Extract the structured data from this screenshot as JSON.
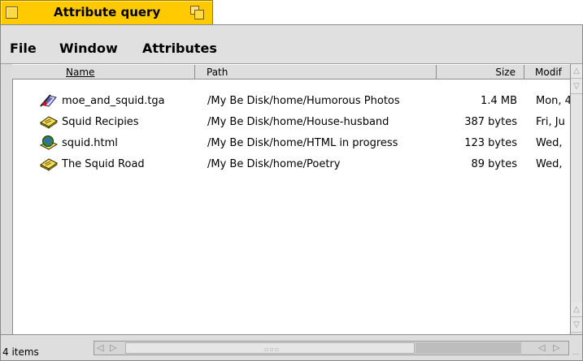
{
  "window": {
    "title": "Attribute query"
  },
  "menu": [
    "File",
    "Window",
    "Attributes"
  ],
  "columns": {
    "name": "Name",
    "path": "Path",
    "size": "Size",
    "modified": "Modif"
  },
  "rows": [
    {
      "icon": "image-file-icon",
      "name": "moe_and_squid.tga",
      "path": "/My Be Disk/home/Humorous Photos",
      "size": "1.4 MB",
      "modified": "Mon, 4"
    },
    {
      "icon": "document-icon",
      "name": "Squid Recipies",
      "path": "/My Be Disk/home/House-husband",
      "size": "387 bytes",
      "modified": "Fri, Ju"
    },
    {
      "icon": "html-file-icon",
      "name": "squid.html",
      "path": "/My Be Disk/home/HTML in progress",
      "size": "123 bytes",
      "modified": "Wed,"
    },
    {
      "icon": "document-icon",
      "name": "The Squid Road",
      "path": "/My Be Disk/home/Poetry",
      "size": "89 bytes",
      "modified": "Wed,"
    }
  ],
  "status": {
    "count": "4 items"
  },
  "colors": {
    "title_tab": "#ffcb00",
    "chrome": "#dcdcdc"
  }
}
